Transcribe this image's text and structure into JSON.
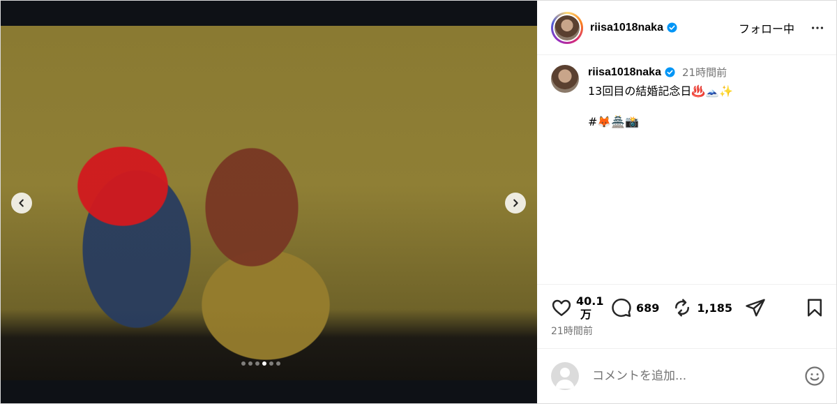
{
  "post": {
    "media": {
      "photo_alt": "",
      "carousel_total": 6,
      "carousel_active_index": 3
    },
    "header": {
      "username": "riisa1018naka",
      "follow_label": "フォロー中",
      "more_icon": "more-horizontal-icon",
      "verified_icon": "verified-badge-icon"
    },
    "caption": {
      "username": "riisa1018naka",
      "time_ago": "21時間前",
      "text": "13回目の結婚記念日♨️🗻✨\n\n#🦊🏯📸"
    },
    "actions": {
      "like_count_line1": "40.1",
      "like_count_line2": "万",
      "comment_count": "689",
      "repost_count": "1,185",
      "posted_ago": "21時間前",
      "icons": [
        "heart-icon",
        "comment-icon",
        "repost-icon",
        "share-icon",
        "bookmark-icon"
      ]
    },
    "comment_box": {
      "placeholder": "コメントを追加...",
      "emoji_icon": "smiley-icon"
    },
    "colors": {
      "verified_blue": "#0095f6",
      "secondary_text": "#737373",
      "media_background": "#0e1116"
    }
  }
}
